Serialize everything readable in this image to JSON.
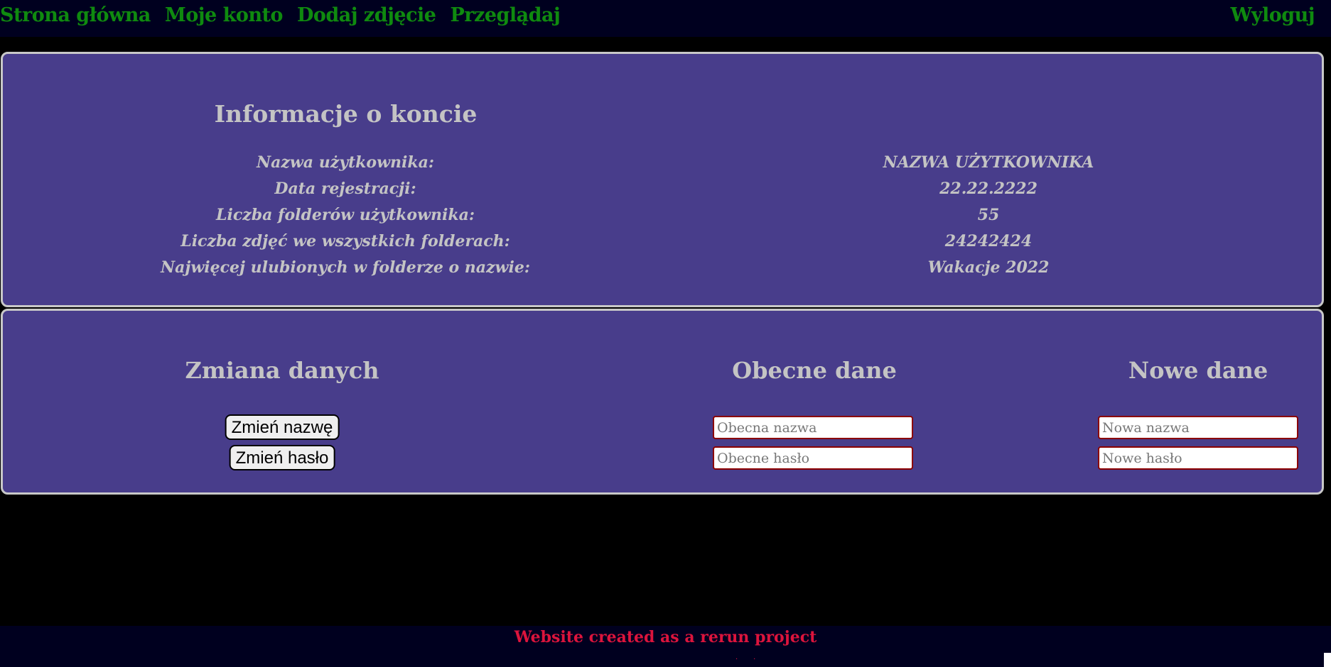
{
  "nav": {
    "items": [
      {
        "label": "Strona główna"
      },
      {
        "label": "Moje konto"
      },
      {
        "label": "Dodaj zdjęcie"
      },
      {
        "label": "Przeglądaj"
      }
    ],
    "logout_label": "Wyloguj"
  },
  "account_info": {
    "title": "Informacje o koncie",
    "rows": [
      {
        "label": "Nazwa użytkownika:",
        "value": "NAZWA UŻYTKOWNIKA"
      },
      {
        "label": "Data rejestracji:",
        "value": "22.22.2222"
      },
      {
        "label": "Liczba folderów użytkownika:",
        "value": "55"
      },
      {
        "label": "Liczba zdjęć we wszystkich folderach:",
        "value": "24242424"
      },
      {
        "label": "Najwięcej ulubionych w folderze o nazwie:",
        "value": "Wakacje 2022"
      }
    ]
  },
  "change_data": {
    "title": "Zmiana danych",
    "current_title": "Obecne dane",
    "new_title": "Nowe dane",
    "change_name_button": "Zmień nazwę",
    "change_password_button": "Zmień hasło",
    "current_name_placeholder": "Obecna nazwa",
    "current_password_placeholder": "Obecne hasło",
    "new_name_placeholder": "Nowa nazwa",
    "new_password_placeholder": "Nowe hasło"
  },
  "footer": {
    "text": "Website created as a rerun project"
  },
  "colors": {
    "nav_bg": "#00001f",
    "nav_link": "#0f8a0f",
    "panel_bg": "#483d8b",
    "panel_border": "#c8c8c8",
    "text_light": "#c4c4c4",
    "footer_text": "#dc143c",
    "input_border": "#8b0000"
  }
}
